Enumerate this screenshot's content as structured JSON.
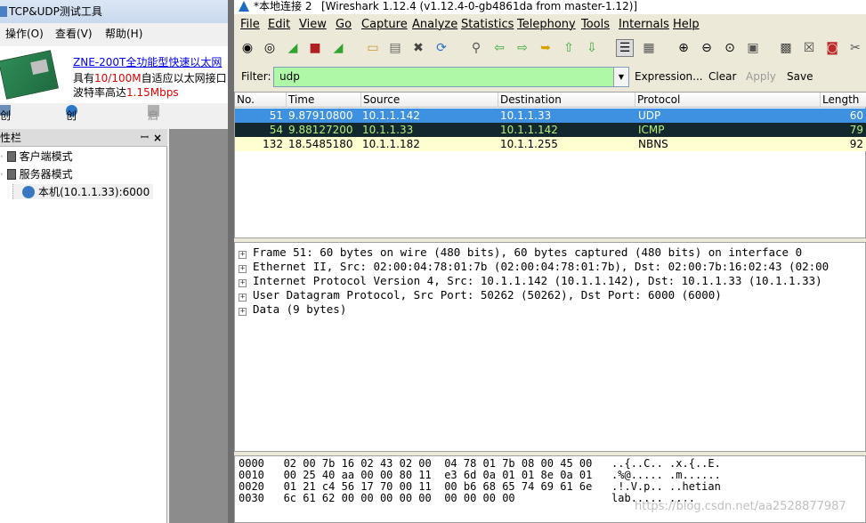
{
  "left_app": {
    "title": "TCP&UDP测试工具",
    "menu": [
      "操作(O)",
      "查看(V)",
      "帮助(H)"
    ],
    "ad": {
      "line1": "ZNE-200T全功能型快速以太网",
      "line2_a": "具有",
      "line2_b": "10/100M",
      "line2_c": "自适应以太网接口",
      "line3_a": "波特率高达",
      "line3_b": "1.15Mbps"
    },
    "toolbar": [
      "创建连接",
      "创建服务器",
      "启动服务器"
    ],
    "panel_title": "属性栏",
    "tree": [
      "客户端模式",
      "服务器模式",
      "本机(10.1.1.33):6000"
    ]
  },
  "wireshark": {
    "title_a": "*本地连接 2",
    "title_b": "[Wireshark 1.12.4  (v1.12.4-0-gb4861da from master-1.12)]",
    "menu": [
      "File",
      "Edit",
      "View",
      "Go",
      "Capture",
      "Analyze",
      "Statistics",
      "Telephony",
      "Tools",
      "Internals",
      "Help"
    ],
    "filter": {
      "label": "Filter:",
      "value": "udp",
      "expression": "Expression...",
      "clear": "Clear",
      "apply": "Apply",
      "save": "Save"
    },
    "columns": [
      "No.",
      "Time",
      "Source",
      "Destination",
      "Protocol",
      "Length"
    ],
    "packets": [
      {
        "no": "51",
        "time": "9.87910800",
        "src": "10.1.1.142",
        "dst": "10.1.1.33",
        "proto": "UDP",
        "len": "60"
      },
      {
        "no": "54",
        "time": "9.88127200",
        "src": "10.1.1.33",
        "dst": "10.1.1.142",
        "proto": "ICMP",
        "len": "79"
      },
      {
        "no": "132",
        "time": "18.5485180",
        "src": "10.1.1.182",
        "dst": "10.1.1.255",
        "proto": "NBNS",
        "len": "92"
      }
    ],
    "details": [
      "Frame 51: 60 bytes on wire (480 bits), 60 bytes captured (480 bits) on interface 0",
      "Ethernet II, Src: 02:00:04:78:01:7b (02:00:04:78:01:7b), Dst: 02:00:7b:16:02:43 (02:00",
      "Internet Protocol Version 4, Src: 10.1.1.142 (10.1.1.142), Dst: 10.1.1.33 (10.1.1.33)",
      "User Datagram Protocol, Src Port: 50262 (50262), Dst Port: 6000 (6000)",
      "Data (9 bytes)"
    ],
    "hex": [
      "0000   02 00 7b 16 02 43 02 00  04 78 01 7b 08 00 45 00   ..{..C.. .x.{..E.",
      "0010   00 25 40 aa 00 00 80 11  e3 6d 0a 01 01 8e 0a 01   .%@..... .m......",
      "0020   01 21 c4 56 17 70 00 11  00 b6 68 65 74 69 61 6e   .!.V.p.. ..hetian",
      "0030   6c 61 62 00 00 00 00 00  00 00 00 00               lab..... ...."
    ],
    "watermark": "https://blog.csdn.net/aa2528877987"
  },
  "colors": {
    "selected_row": "#3d91e0",
    "icmp_row": "#12272e",
    "icmp_text": "#b5f07c",
    "nbns_row": "#fefed0",
    "filter_ok": "#aff8a8"
  }
}
